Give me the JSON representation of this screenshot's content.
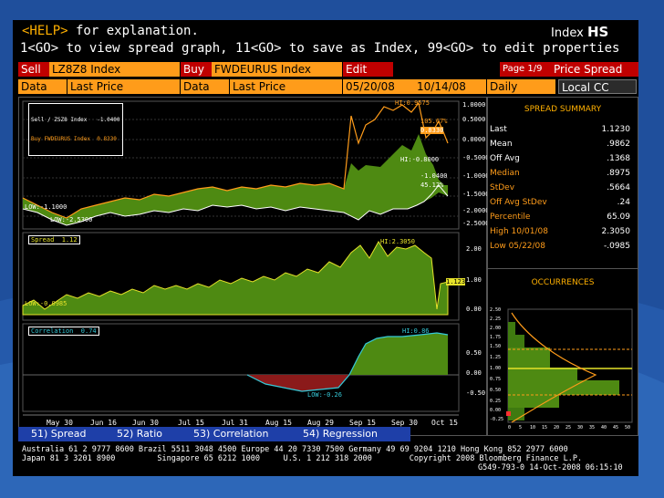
{
  "header": {
    "help_key": "<HELP>",
    "help_text": " for explanation.",
    "line2": "1<GO> to view spread graph, 11<GO> to save as Index, 99<GO> to edit properties",
    "index_label": "Index",
    "index_code": "HS"
  },
  "toolbar": {
    "sell_label": "Sell",
    "sell_value": "LZ8Z8 Index",
    "buy_label": "Buy",
    "buy_value": "FWDEURUS Index",
    "edit_label": "Edit",
    "page_info": "Page 1/9",
    "page_title": "Price Spread",
    "data_label_1": "Data",
    "data_value_1": "Last Price",
    "data_label_2": "Data",
    "data_value_2": "Last Price",
    "start_date": "05/20/08",
    "end_date": "10/14/08",
    "period": "Daily",
    "currency": "Local CC"
  },
  "panels": {
    "p1_legend_1": "Sell / ZSZ8 Index   -1.0400",
    "p1_legend_2": "Buy FWDEURUS Index  0.8330",
    "p1_hi": "HI:0.9575",
    "p1_low": "LOW:-1.1000",
    "p1_low2": "LOW:-2.5300",
    "p1_mark1": "105.67%",
    "p1_mark2": "0.8330",
    "p1_hi2": "HI:-0.8000",
    "p1_mark3": "-1.0400",
    "p1_mark4": "45.12%",
    "p1_yticks": [
      "1.0000",
      "0.5000",
      "0.0000",
      "-0.5000",
      "-1.0000",
      "-1.5000",
      "-2.0000",
      "-2.5000"
    ],
    "p2_legend": "Spread  1.12",
    "p2_hi": "HI:2.3050",
    "p2_low": "LOW:-0.0985",
    "p2_last": "1.123",
    "p2_yticks": [
      "2.00",
      "1.00",
      "0.00"
    ],
    "p3_legend": "Correlation  0.74",
    "p3_hi": "HI:0.86",
    "p3_low": "LOW:-0.26",
    "p3_yticks": [
      "0.50",
      "0.00",
      "-0.50"
    ],
    "x_labels": [
      "May 30",
      "Jun 16",
      "Jun 30",
      "Jul 15",
      "Jul 31",
      "Aug 15",
      "Aug 29",
      "Sep 15",
      "Sep 30",
      "Oct 15"
    ]
  },
  "summary": {
    "title": "SPREAD SUMMARY",
    "rows": [
      {
        "label": "Last",
        "value": "1.1230"
      },
      {
        "label": "Mean",
        "value": ".9862"
      },
      {
        "label": "Off Avg",
        "value": ".1368"
      },
      {
        "label": "Median",
        "value": ".8975"
      },
      {
        "label": "StDev",
        "value": ".5664"
      },
      {
        "label": "Off Avg StDev",
        "value": ".24"
      },
      {
        "label": "Percentile",
        "value": "65.09"
      },
      {
        "label": "High 10/01/08",
        "value": "2.3050"
      },
      {
        "label": "Low 05/22/08",
        "value": "-.0985"
      }
    ]
  },
  "occurrences": {
    "title": "OCCURRENCES",
    "y_labels": [
      "2.50",
      "2.25",
      "2.00",
      "1.75",
      "1.50",
      "1.25",
      "1.00",
      "0.75",
      "0.50",
      "0.25",
      "0.00",
      "-0.25"
    ],
    "x_labels": [
      "0",
      "5",
      "10",
      "15",
      "20",
      "25",
      "30",
      "35",
      "40",
      "45",
      "50"
    ]
  },
  "tabs": [
    {
      "label": "51) Spread"
    },
    {
      "label": "52) Ratio"
    },
    {
      "label": "53) Correlation"
    },
    {
      "label": "54) Regression"
    }
  ],
  "footer": {
    "line1": "Australia 61 2 9777 8600 Brazil 5511 3048 4500 Europe 44 20 7330 7500 Germany 49 69 9204 1210 Hong Kong 852 2977 6000",
    "line2": "Japan 81 3 3201 8900         Singapore 65 6212 1000     U.S. 1 212 318 2000        Copyright 2008 Bloomberg Finance L.P.",
    "line3": "G549-793-0 14-Oct-2008 06:15:10"
  },
  "colors": {
    "accent": "#ff9c1a",
    "area_green": "#4e8a12",
    "line_yellow": "#e6e22a",
    "neg_red": "#8b1a1a",
    "corr_cyan": "#35c9d8"
  }
}
